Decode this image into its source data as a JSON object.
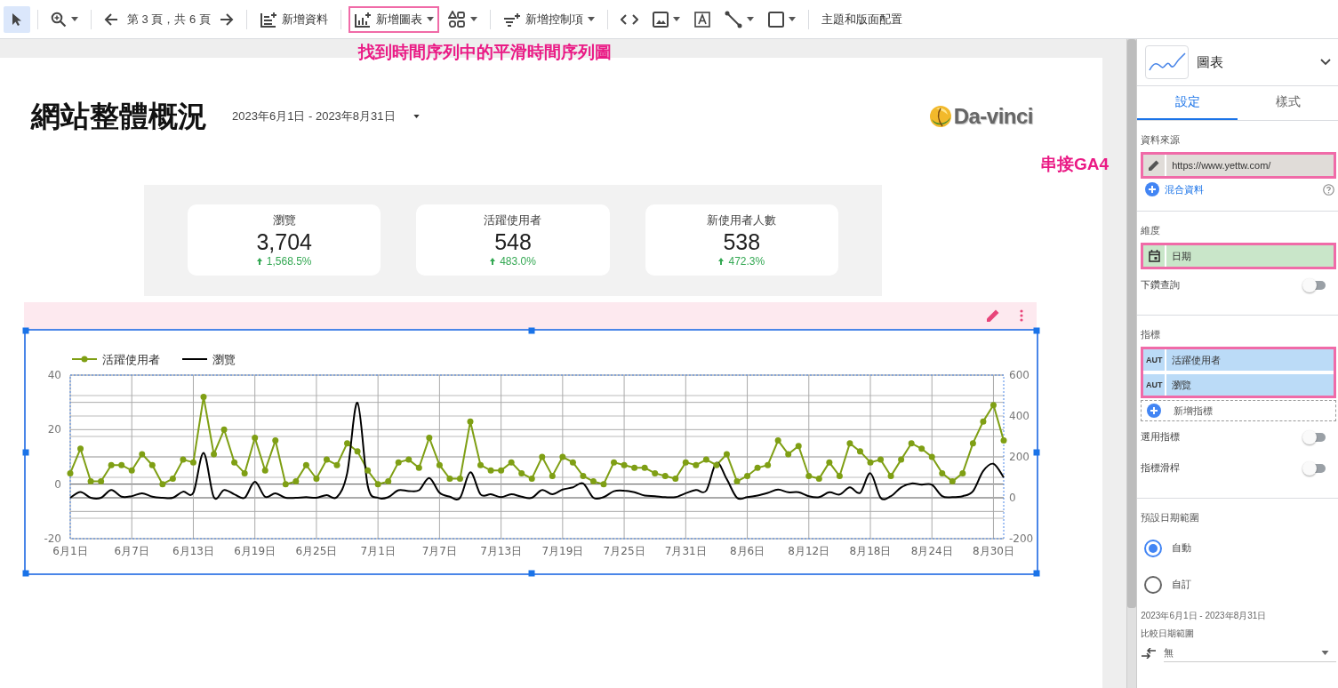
{
  "toolbar": {
    "page_label": "第 3 頁，共 6 頁",
    "add_data": "新增資料",
    "add_chart": {
      "label": "新增圖表",
      "highlighted": true
    },
    "add_control": "新增控制項",
    "theme": "主題和版面配置"
  },
  "annotations": {
    "top": "找到時間序列中的平滑時間序列圖",
    "side": "串接GA4"
  },
  "report": {
    "title": "網站整體概況",
    "date_range": "2023年6月1日 - 2023年8月31日",
    "logo": "Da-vinci",
    "scorecards": [
      {
        "label": "瀏覽",
        "value": "3,704",
        "change": "1,568.5%"
      },
      {
        "label": "活躍使用者",
        "value": "548",
        "change": "483.0%"
      },
      {
        "label": "新使用者人數",
        "value": "538",
        "change": "472.3%"
      }
    ]
  },
  "chart": {
    "selected": true,
    "chart_data": {
      "type": "line",
      "categories": [
        "6月1日",
        null,
        null,
        null,
        null,
        null,
        "6月7日",
        null,
        null,
        null,
        null,
        null,
        "6月13日",
        null,
        null,
        null,
        null,
        null,
        "6月19日",
        null,
        null,
        null,
        null,
        null,
        "6月25日",
        null,
        null,
        null,
        null,
        null,
        "7月1日",
        null,
        null,
        null,
        null,
        null,
        "7月7日",
        null,
        null,
        null,
        null,
        null,
        "7月13日",
        null,
        null,
        null,
        null,
        null,
        "7月19日",
        null,
        null,
        null,
        null,
        null,
        "7月25日",
        null,
        null,
        null,
        null,
        null,
        "7月31日",
        null,
        null,
        null,
        null,
        null,
        "8月6日",
        null,
        null,
        null,
        null,
        null,
        "8月12日",
        null,
        null,
        null,
        null,
        null,
        "8月18日",
        null,
        null,
        null,
        null,
        null,
        "8月24日",
        null,
        null,
        null,
        null,
        null,
        "8月30日",
        null
      ],
      "series": [
        {
          "name": "活躍使用者",
          "color": "#7f9f14",
          "marker": "circle",
          "values": [
            4,
            13,
            1,
            1,
            7,
            7,
            5,
            11,
            7,
            0,
            2,
            9,
            8,
            32,
            11,
            20,
            8,
            4,
            17,
            5,
            16,
            0,
            1,
            7,
            2,
            9,
            7,
            15,
            12,
            5,
            0,
            1,
            8,
            9,
            6,
            17,
            7,
            2,
            2,
            23,
            7,
            5,
            5,
            8,
            4,
            2,
            10,
            3,
            10,
            8,
            3,
            1,
            0,
            8,
            7,
            6,
            6,
            4,
            3,
            2,
            8,
            7,
            9,
            7,
            11,
            1,
            3,
            6,
            7,
            16,
            11,
            14,
            3,
            2,
            8,
            3,
            15,
            12,
            8,
            9,
            3,
            9,
            15,
            13,
            10,
            4,
            1,
            4,
            15,
            23,
            29,
            16
          ]
        },
        {
          "name": "瀏覽",
          "color": "#000000",
          "axis": "y2",
          "values": [
            0,
            28,
            0,
            0,
            38,
            5,
            8,
            22,
            5,
            0,
            0,
            30,
            25,
            220,
            3,
            38,
            17,
            0,
            78,
            5,
            22,
            0,
            0,
            3,
            0,
            13,
            3,
            120,
            465,
            60,
            0,
            3,
            37,
            33,
            37,
            97,
            25,
            5,
            0,
            125,
            17,
            17,
            3,
            17,
            5,
            0,
            38,
            17,
            40,
            51,
            70,
            0,
            3,
            32,
            35,
            27,
            11,
            8,
            3,
            3,
            22,
            38,
            35,
            171,
            91,
            0,
            3,
            11,
            24,
            40,
            27,
            27,
            8,
            3,
            27,
            16,
            51,
            24,
            120,
            0,
            8,
            51,
            70,
            64,
            64,
            8,
            3,
            8,
            32,
            131,
            166,
            99
          ]
        }
      ],
      "ylim": [
        -20,
        40
      ],
      "yticks": [
        -20,
        0,
        20,
        40
      ],
      "y2lim": [
        -200,
        600
      ],
      "y2ticks": [
        -200,
        0,
        200,
        400,
        600
      ],
      "grid": true,
      "legend": "top-left"
    }
  },
  "panel": {
    "chart_type": "圖表",
    "tabs": [
      {
        "label": "設定",
        "selected": true
      },
      {
        "label": "樣式",
        "selected": false
      }
    ],
    "data_source": {
      "label": "資料來源",
      "value": "https://www.yettw.com/",
      "highlighted": true,
      "blend": "混合資料"
    },
    "dimension": {
      "label": "維度",
      "value": "日期",
      "highlighted": true
    },
    "drill_down": {
      "label": "下鑽查詢",
      "on": false
    },
    "metrics": {
      "label": "指標",
      "highlighted": true,
      "items": [
        {
          "badge": "AUT",
          "name": "活躍使用者"
        },
        {
          "badge": "AUT",
          "name": "瀏覽"
        }
      ],
      "add": "新增指標"
    },
    "toggles": [
      {
        "label": "選用指標",
        "on": false
      },
      {
        "label": "指標滑桿",
        "on": false
      }
    ],
    "default_range": {
      "label": "預設日期範圍",
      "options": [
        {
          "label": "自動",
          "selected": true
        },
        {
          "label": "自訂",
          "selected": false
        }
      ],
      "range": "2023年6月1日 - 2023年8月31日"
    },
    "compare": {
      "label": "比較日期範圍",
      "value": "無"
    }
  }
}
